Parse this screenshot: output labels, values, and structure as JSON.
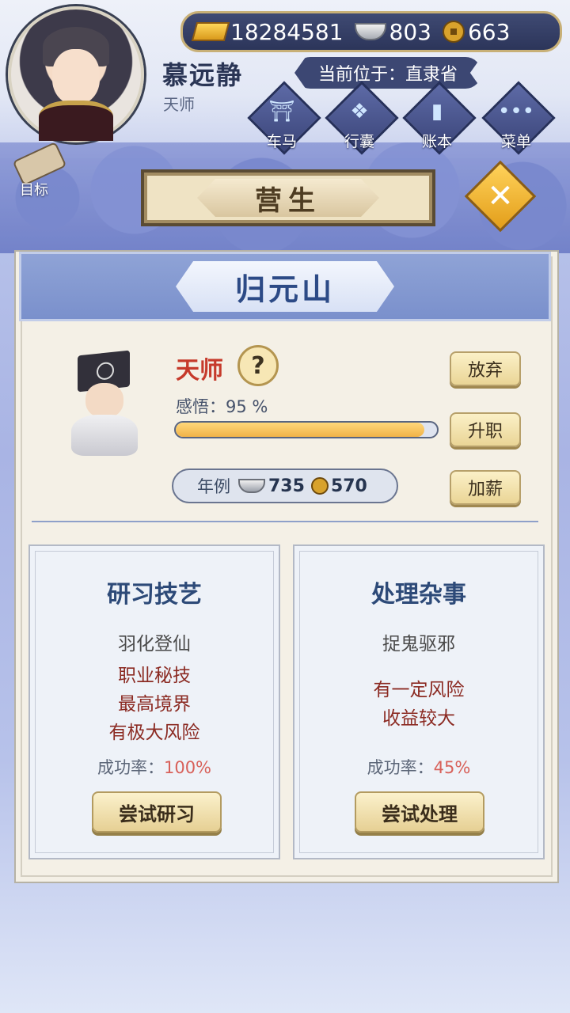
{
  "player": {
    "name": "慕远静",
    "title": "天师",
    "location": "当前位于：直隶省"
  },
  "resources": {
    "gold": "18284581",
    "silver": "803",
    "coins": "663"
  },
  "nav": {
    "carriage": "车马",
    "bag": "行囊",
    "ledger": "账本",
    "menu": "菜单",
    "target": "目标"
  },
  "screen": {
    "title": "营生",
    "place": "归元山"
  },
  "job": {
    "name": "天师",
    "help": "?",
    "insight_label": "感悟：",
    "insight_value": "95 %",
    "insight_fraction": 0.95,
    "abandon": "放弃",
    "promote": "升职",
    "raise": "加薪",
    "salary_label": "年例",
    "salary_silver": "735",
    "salary_coins": "570"
  },
  "cards": [
    {
      "title": "研习技艺",
      "line1": "羽化登仙",
      "line2": "职业秘技",
      "line3": "最高境界",
      "line4": "有极大风险",
      "rate_label": "成功率：",
      "rate_value": "100%",
      "button": "尝试研习"
    },
    {
      "title": "处理杂事",
      "line1": "捉鬼驱邪",
      "line2": "有一定风险",
      "line3": "收益较大",
      "rate_label": "成功率：",
      "rate_value": "45%",
      "button": "尝试处理"
    }
  ]
}
